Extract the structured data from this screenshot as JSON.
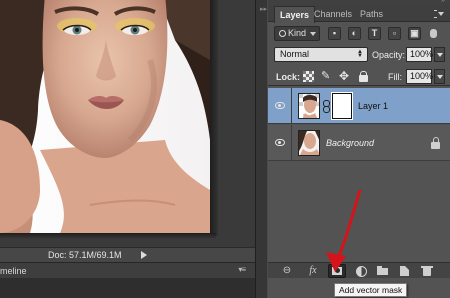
{
  "status": {
    "doc_info": "Doc: 57.1M/69.1M",
    "timeline_label": "meline"
  },
  "panel": {
    "tabs": [
      {
        "label": "Layers",
        "active": true
      },
      {
        "label": "Channels",
        "active": false
      },
      {
        "label": "Paths",
        "active": false
      }
    ],
    "filter": {
      "kind_label": "Kind",
      "icons": [
        "image-filter-icon",
        "adjustment-filter-icon",
        "type-filter-icon",
        "shape-filter-icon",
        "smart-object-filter-icon"
      ],
      "type_glyph": "T"
    },
    "blend_mode": "Normal",
    "opacity_label": "Opacity:",
    "opacity_value": "100%",
    "lock_label": "Lock:",
    "fill_label": "Fill:",
    "fill_value": "100%",
    "layers": [
      {
        "name": "Layer 1",
        "selected": true,
        "visible": true,
        "has_mask": true
      },
      {
        "name": "Background",
        "selected": false,
        "visible": true,
        "locked": true
      }
    ],
    "footer_icons": [
      "link-layers-icon",
      "fx-icon",
      "add-vector-mask-icon",
      "adjustment-layer-icon",
      "group-folder-icon",
      "new-layer-icon",
      "trash-icon"
    ],
    "fx_label": "fx"
  },
  "tooltip": "Add vector mask",
  "colors": {
    "panel_bg": "#535353",
    "selected_layer": "#7fa0c8",
    "annotation_arrow": "#d4141a"
  }
}
